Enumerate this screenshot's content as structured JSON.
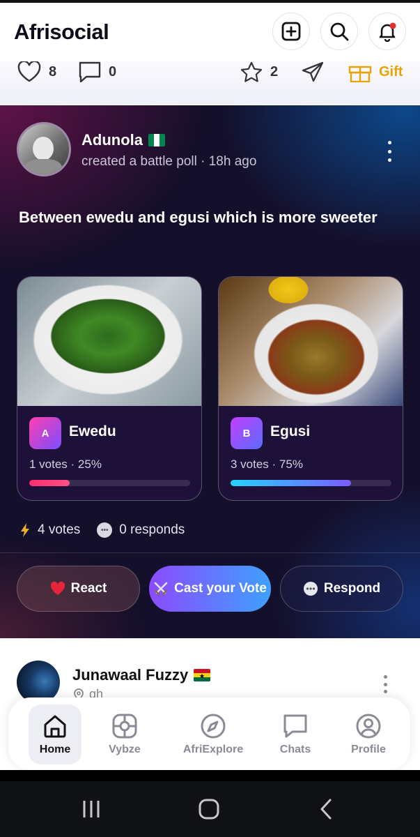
{
  "header": {
    "title": "Afrisocial"
  },
  "prev_post": {
    "likes": "8",
    "comments": "0",
    "stars": "2",
    "gift_label": "Gift"
  },
  "poll_post": {
    "author": "Adunola",
    "author_flag": "nigeria",
    "meta": "created a battle poll · 18h ago",
    "question": "Between ewedu and egusi which is more sweeter",
    "options": [
      {
        "badge": "A",
        "name": "Ewedu",
        "stats": "1 votes · 25%",
        "percent": 25
      },
      {
        "badge": "B",
        "name": "Egusi",
        "stats": "3 votes · 75%",
        "percent": 75
      }
    ],
    "total_votes": "4 votes",
    "responds": "0 responds",
    "actions": {
      "react": "React",
      "vote": "Cast your Vote",
      "respond": "Respond"
    }
  },
  "next_post": {
    "author": "Junawaal Fuzzy",
    "author_flag": "ghana",
    "location": "gh"
  },
  "bottom_nav": {
    "items": [
      {
        "label": "Home",
        "icon": "home-icon",
        "active": true
      },
      {
        "label": "Vybze",
        "icon": "vybze-icon",
        "active": false
      },
      {
        "label": "AfriExplore",
        "icon": "compass-icon",
        "active": false
      },
      {
        "label": "Chats",
        "icon": "chat-icon",
        "active": false
      },
      {
        "label": "Profile",
        "icon": "profile-icon",
        "active": false
      }
    ]
  },
  "colors": {
    "accent_gift": "#e8a400",
    "vote_gradient_start": "#8b4bff",
    "vote_gradient_end": "#3fa0ff",
    "bar_a": "#ff2e6e",
    "bar_b": "#25d4ff"
  }
}
